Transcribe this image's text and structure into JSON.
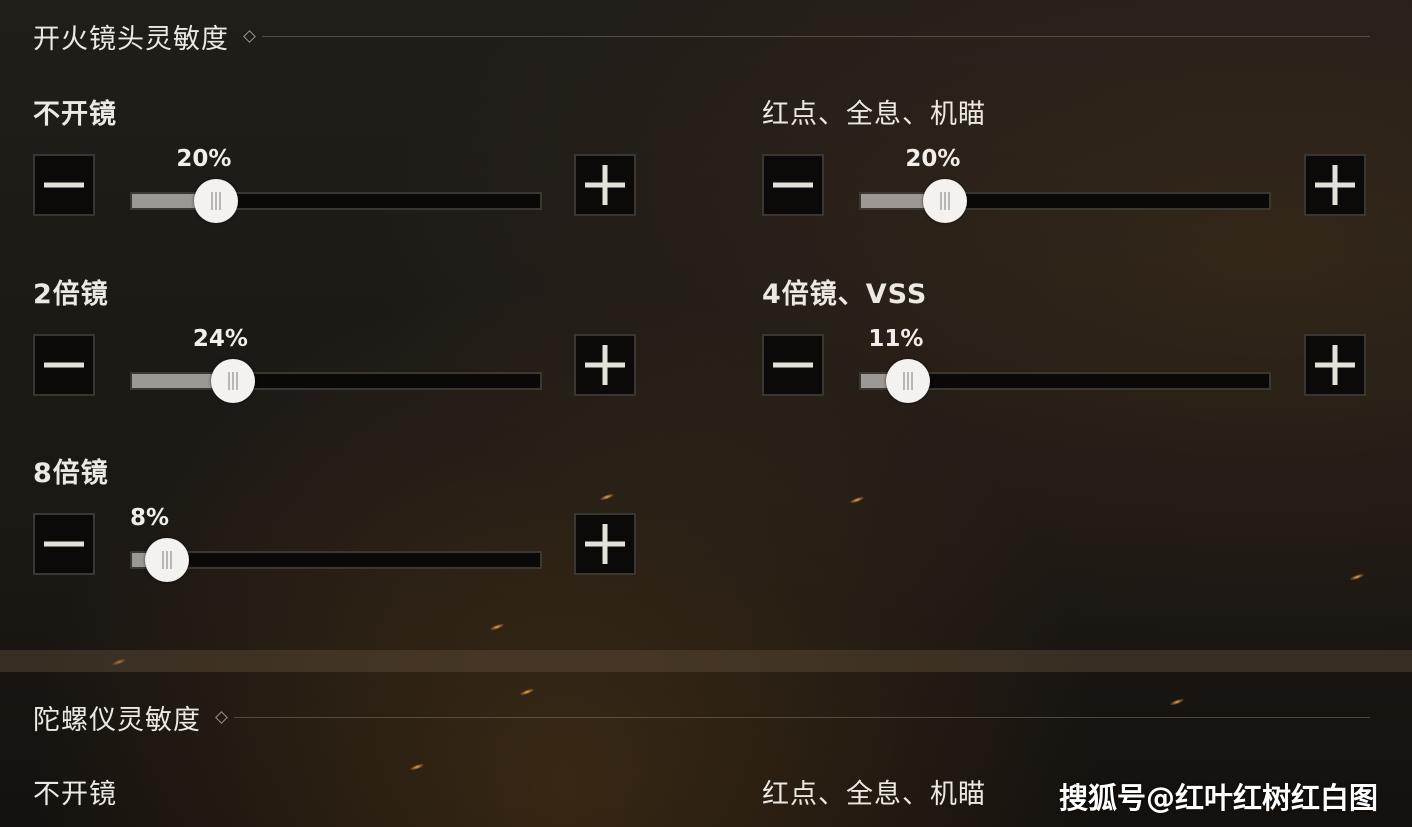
{
  "sections": [
    {
      "title": "开火镜头灵敏度",
      "settings": [
        {
          "label": "不开镜",
          "value_text": "20%",
          "value": 20
        },
        {
          "label": "红点、全息、机瞄",
          "value_text": "20%",
          "value": 20
        },
        {
          "label": "2倍镜",
          "value_text": "24%",
          "value": 24
        },
        {
          "label": "4倍镜、VSS",
          "value_text": "11%",
          "value": 11
        },
        {
          "label": "8倍镜",
          "value_text": "8%",
          "value": 8
        }
      ]
    },
    {
      "title": "陀螺仪灵敏度",
      "settings": [
        {
          "label": "不开镜"
        },
        {
          "label": "红点、全息、机瞄"
        }
      ]
    }
  ],
  "controls": {
    "decrease_icon": "minus-icon",
    "increase_icon": "plus-icon",
    "section_icon": "diamond-icon"
  },
  "watermark": "搜狐号@红叶红树红白图",
  "colors": {
    "track": "#0a0908",
    "fill": "#9c9893",
    "thumb": "#f4f2ef",
    "button_bg": "#0b0a09",
    "text": "#ece8e2"
  }
}
